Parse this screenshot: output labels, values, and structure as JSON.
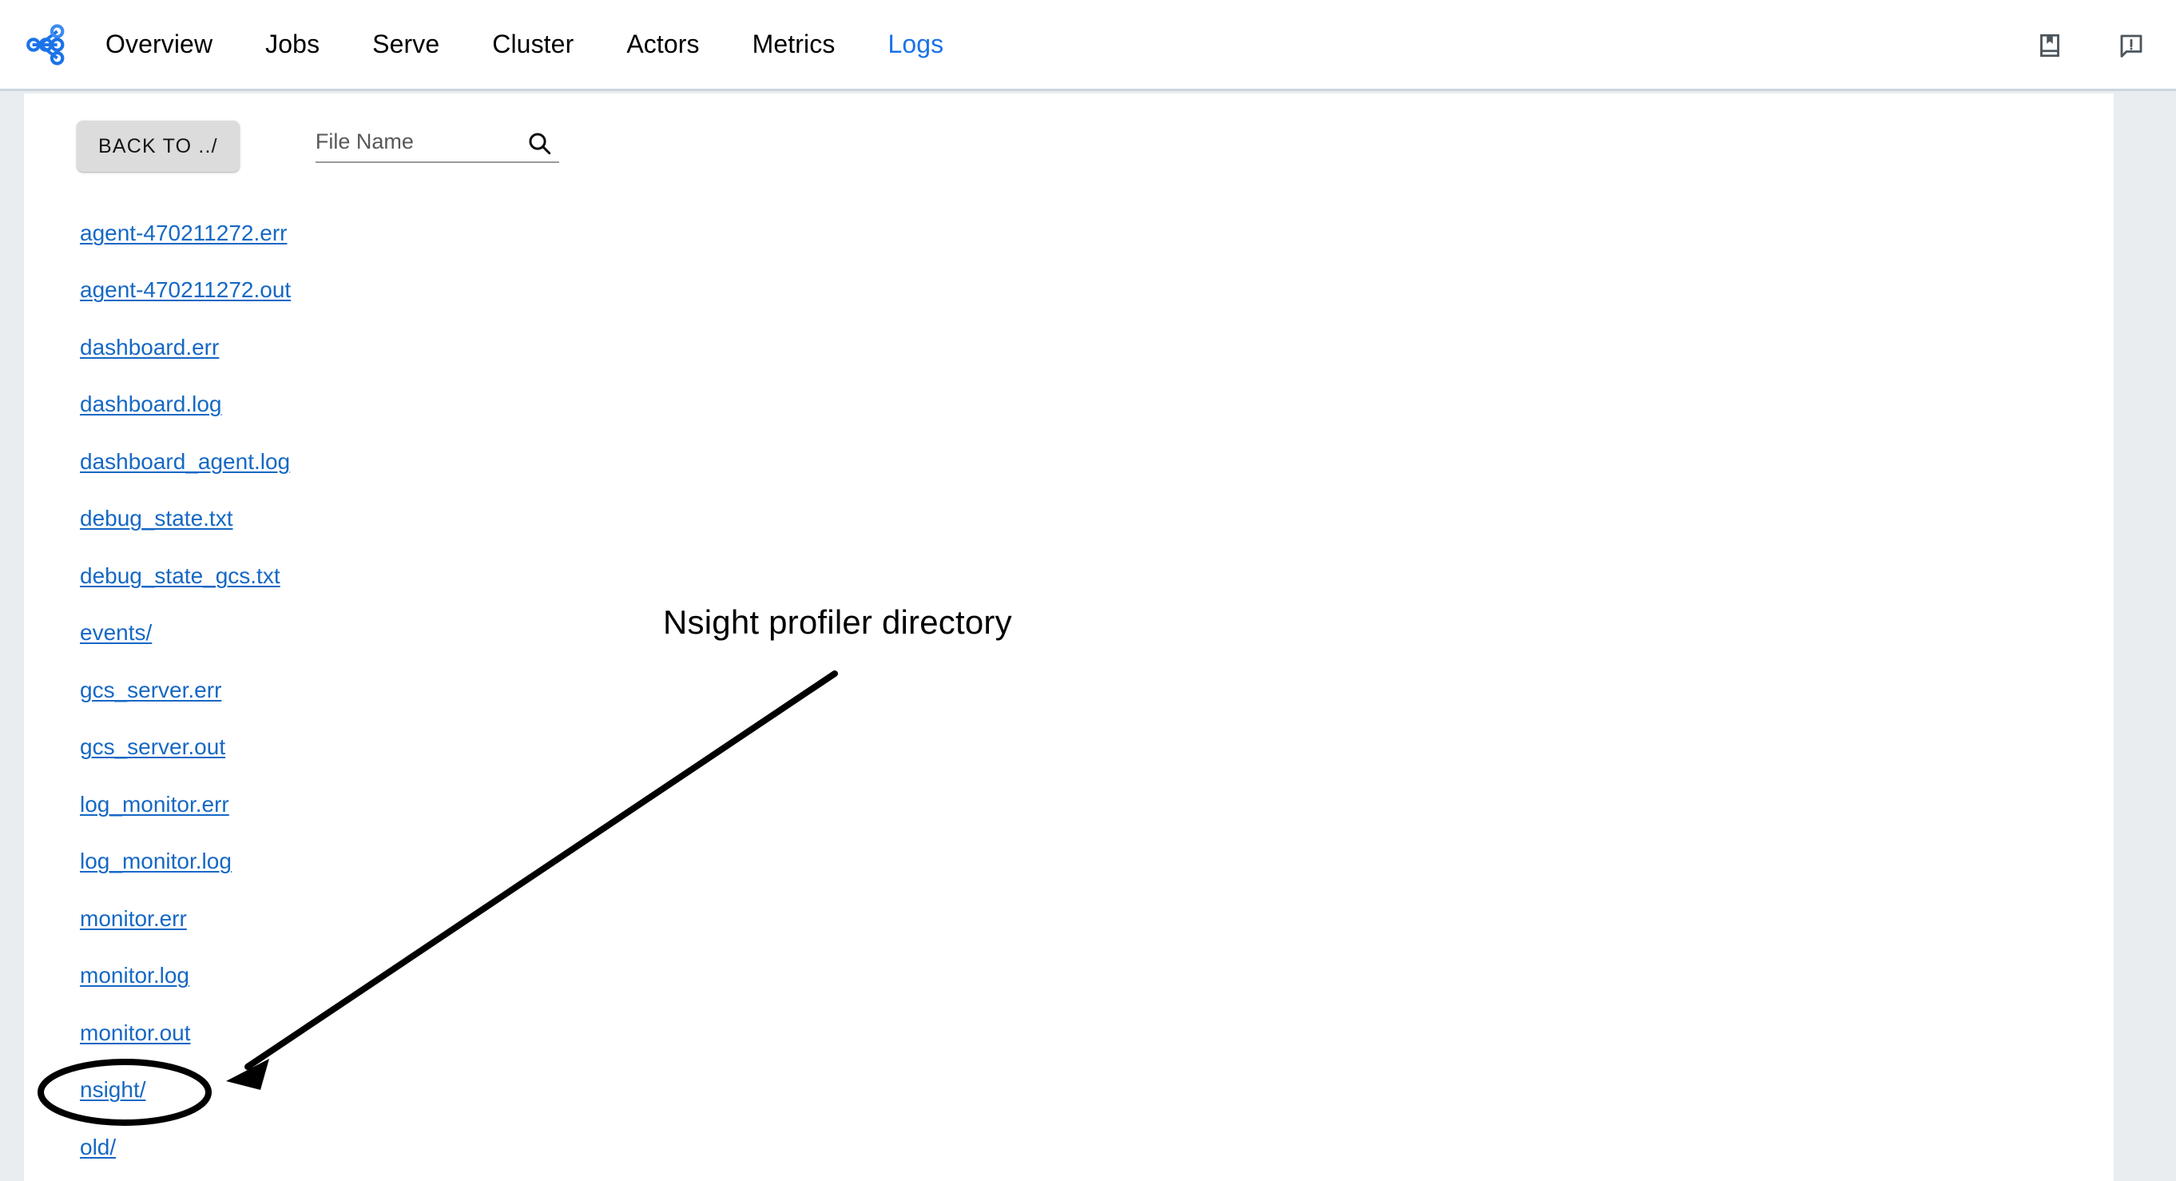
{
  "header": {
    "logo_name": "ray-logo",
    "nav": [
      {
        "label": "Overview",
        "active": false
      },
      {
        "label": "Jobs",
        "active": false
      },
      {
        "label": "Serve",
        "active": false
      },
      {
        "label": "Cluster",
        "active": false
      },
      {
        "label": "Actors",
        "active": false
      },
      {
        "label": "Metrics",
        "active": false
      },
      {
        "label": "Logs",
        "active": true
      }
    ],
    "actions": [
      {
        "icon": "book-bookmark-icon",
        "title": "Documentation"
      },
      {
        "icon": "feedback-alert-icon",
        "title": "Feedback"
      }
    ]
  },
  "toolbar": {
    "back_label": "BACK TO ../",
    "search_placeholder": "File Name",
    "search_value": "",
    "search_icon": "magnifier-icon"
  },
  "files": [
    {
      "name": "agent-470211272.err",
      "is_dir": false
    },
    {
      "name": "agent-470211272.out",
      "is_dir": false
    },
    {
      "name": "dashboard.err",
      "is_dir": false
    },
    {
      "name": "dashboard.log",
      "is_dir": false
    },
    {
      "name": "dashboard_agent.log",
      "is_dir": false
    },
    {
      "name": "debug_state.txt",
      "is_dir": false
    },
    {
      "name": "debug_state_gcs.txt",
      "is_dir": false
    },
    {
      "name": "events/",
      "is_dir": true
    },
    {
      "name": "gcs_server.err",
      "is_dir": false
    },
    {
      "name": "gcs_server.out",
      "is_dir": false
    },
    {
      "name": "log_monitor.err",
      "is_dir": false
    },
    {
      "name": "log_monitor.log",
      "is_dir": false
    },
    {
      "name": "monitor.err",
      "is_dir": false
    },
    {
      "name": "monitor.log",
      "is_dir": false
    },
    {
      "name": "monitor.out",
      "is_dir": false
    },
    {
      "name": "nsight/",
      "is_dir": true
    },
    {
      "name": "old/",
      "is_dir": true
    }
  ],
  "annotation": {
    "text": "Nsight profiler directory",
    "highlight_target": "nsight/",
    "color": "#000000"
  },
  "colors": {
    "link": "#1668c4",
    "accent": "#1a73e8",
    "page_background": "#e9edf0",
    "panel_background": "#ffffff",
    "header_border": "#ccd6e0",
    "button_background": "#dcdcdc"
  }
}
